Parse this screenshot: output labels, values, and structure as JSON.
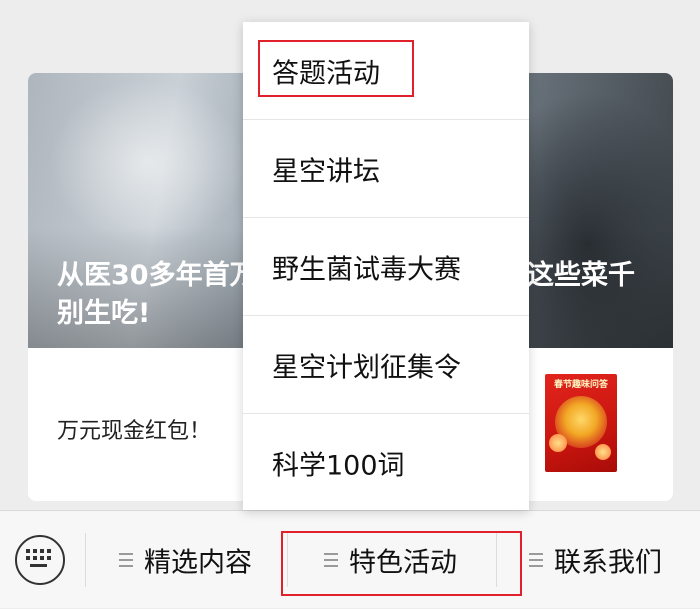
{
  "article": {
    "headline_left": "从医30多年首万别生吃!",
    "headline_right": "这些菜千",
    "footer_text": "万元现金红包！",
    "thumb_label": "春节趣味问答"
  },
  "dropdown": {
    "items": [
      {
        "label": "答题活动"
      },
      {
        "label": "星空讲坛"
      },
      {
        "label": "野生菌试毒大赛"
      },
      {
        "label": "星空计划征集令"
      },
      {
        "label": "科学100词"
      }
    ]
  },
  "bottombar": {
    "tabs": [
      {
        "label": "精选内容"
      },
      {
        "label": "特色活动"
      },
      {
        "label": "联系我们"
      }
    ]
  },
  "icons": {
    "keyboard": "keyboard-icon",
    "menu": "menu-lines-icon"
  },
  "colors": {
    "highlight": "#e0202a",
    "background": "#ededed"
  }
}
